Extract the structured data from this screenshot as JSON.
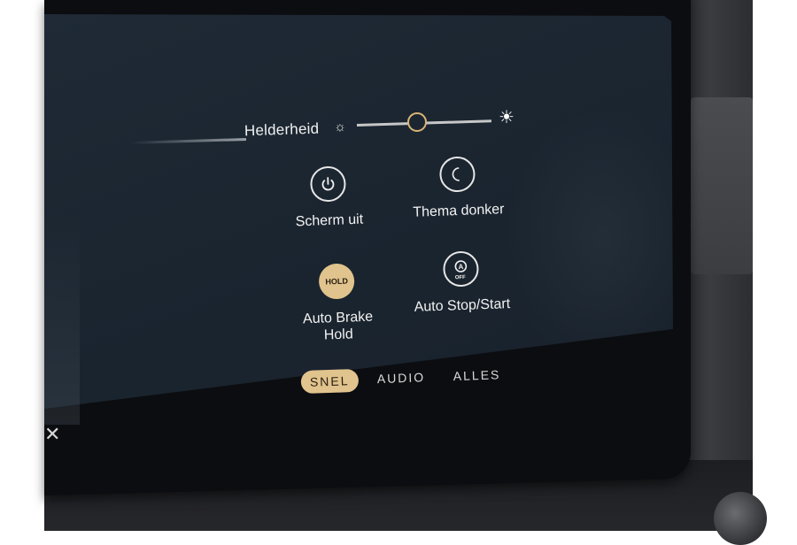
{
  "brightness": {
    "label": "Helderheid",
    "level": 0.45,
    "icon_low": "sun-small-icon",
    "icon_high": "sun-large-icon"
  },
  "quick": [
    {
      "label": "Scherm uit",
      "icon": "power-icon"
    },
    {
      "label": "Thema donker",
      "icon": "moon-icon"
    },
    {
      "label_line1": "Auto Brake",
      "label_line2": "Hold",
      "icon_text": "HOLD",
      "active": true
    },
    {
      "label": "Auto Stop/Start",
      "icon": "auto-stop-start-icon",
      "icon_text": "OFF"
    }
  ],
  "tabs": [
    {
      "label": "SNEL",
      "active": true
    },
    {
      "label": "AUDIO",
      "active": false
    },
    {
      "label": "ALLES",
      "active": false
    }
  ],
  "colors": {
    "accent": "#e1c38d",
    "screen_bg": "#1b2530",
    "text": "#f2f2f2"
  }
}
